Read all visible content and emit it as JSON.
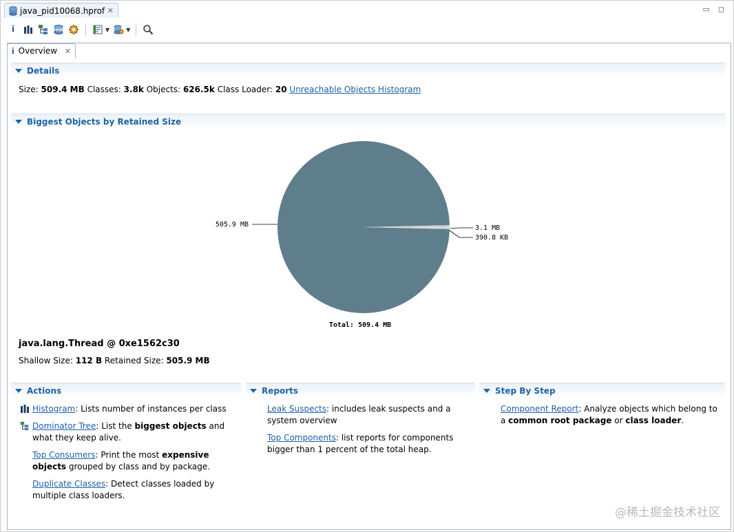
{
  "editor": {
    "tab_title": "java_pid10068.hprof",
    "close_glyph": "✕",
    "minimize_glyph": "▭",
    "maximize_glyph": "◻"
  },
  "toolbar": {
    "icons": [
      "info-icon",
      "histogram-icon",
      "dominator-tree-icon",
      "oql-icon",
      "heap-dump-overview-icon",
      "run-report-icon",
      "query-browser-icon",
      "search-icon"
    ],
    "dropdown_glyph": "▼",
    "info_glyph": "i"
  },
  "overview_tab": {
    "label": "Overview",
    "info_glyph": "i",
    "close_glyph": "✕"
  },
  "details": {
    "header": "Details",
    "size_label": "Size:",
    "size_value": "509.4 MB",
    "classes_label": "Classes:",
    "classes_value": "3.8k",
    "objects_label": "Objects:",
    "objects_value": "626.5k",
    "loader_label": "Class Loader:",
    "loader_value": "20",
    "unreachable_link": "Unreachable Objects Histogram"
  },
  "biggest": {
    "header": "Biggest Objects by Retained Size",
    "object_name": "java.lang.Thread @ 0xe1562c30",
    "shallow_label": "Shallow Size:",
    "shallow_value": "112 B",
    "retained_label": "Retained Size:",
    "retained_value": "505.9 MB"
  },
  "chart_data": {
    "type": "pie",
    "total_label": "Total: 509.4 MB",
    "slices": [
      {
        "label": "505.9 MB",
        "value": 505.9,
        "color": "#5f7e8c"
      },
      {
        "label": "3.1 MB",
        "value": 3.1,
        "color": "#d4d4d4"
      },
      {
        "label": "390.8 KB",
        "value": 0.39,
        "color": "#ececec"
      }
    ]
  },
  "actions": {
    "header": "Actions",
    "items": [
      {
        "link": "Histogram",
        "text": ": Lists number of instances per class"
      },
      {
        "link": "Dominator Tree",
        "pre": ": List the ",
        "bold": "biggest objects",
        "post": " and",
        "line2": "what they keep alive."
      },
      {
        "link": "Top Consumers",
        "pre": ": Print the most ",
        "bold": "expensive",
        "bold2": "objects",
        "line2post": " grouped by class and by package."
      },
      {
        "link": "Duplicate Classes",
        "text": ": Detect classes loaded by",
        "line2": "multiple class loaders."
      }
    ]
  },
  "reports": {
    "header": "Reports",
    "items": [
      {
        "link": "Leak Suspects",
        "text": ": includes leak suspects and a",
        "line2": "system overview"
      },
      {
        "link": "Top Components",
        "text": ": list reports for components",
        "line2": "bigger than 1 percent of the total heap."
      }
    ]
  },
  "stepbystep": {
    "header": "Step By Step",
    "items": [
      {
        "link": "Component Report",
        "text": ": Analyze objects which belong to",
        "pre2": "a ",
        "bold": "common root package",
        "mid": " or ",
        "bold2": "class loader",
        "post": "."
      }
    ]
  },
  "watermark": "@稀土掘金技术社区"
}
